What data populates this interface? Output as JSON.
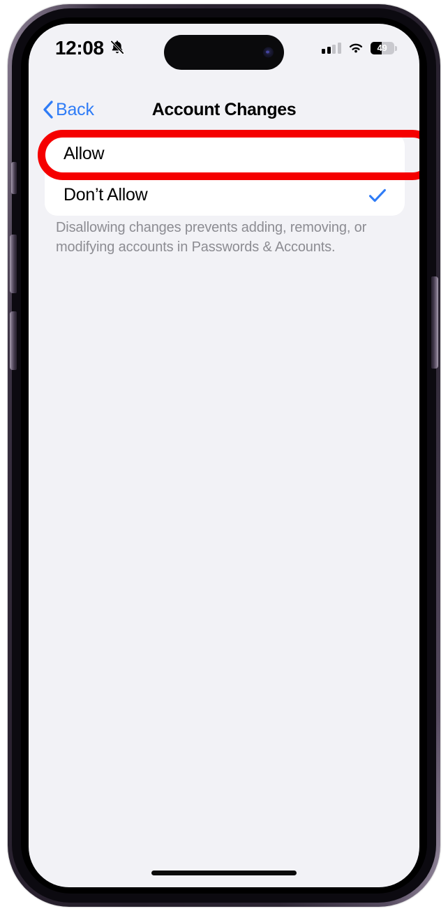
{
  "status_bar": {
    "time": "12:08",
    "silent_icon": "bell-slash-icon",
    "signal_icon": "cellular-signal-icon",
    "signal_bars_filled": 2,
    "signal_bars_total": 4,
    "wifi_icon": "wifi-icon",
    "battery_percent": "49",
    "battery_level": 49,
    "battery_icon": "battery-icon"
  },
  "nav": {
    "back_label": "Back",
    "back_icon": "chevron-left-icon",
    "title": "Account Changes"
  },
  "list": {
    "rows": [
      {
        "label": "Allow",
        "checked": false
      },
      {
        "label": "Don’t Allow",
        "checked": true
      }
    ],
    "check_icon": "checkmark-icon"
  },
  "footer": {
    "note": "Disallowing changes prevents adding, removing, or modifying accounts in Passwords & Accounts."
  },
  "annotation": {
    "type": "oval-highlight",
    "target": "Allow",
    "color": "#f50000"
  },
  "colors": {
    "accent_blue": "#2f7cf6",
    "background": "#f2f2f6",
    "card": "#ffffff",
    "footer_text": "#8c8c92",
    "annotation_red": "#f50000"
  },
  "device": {
    "home_indicator": "home-indicator",
    "dynamic_island": "dynamic-island"
  }
}
